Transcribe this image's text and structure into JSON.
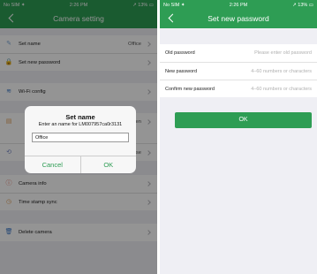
{
  "left": {
    "status": {
      "carrier": "No SIM ✦",
      "time": "2:26 PM",
      "battery": "↗ 13% ▭"
    },
    "title": "Camera setting",
    "items": [
      {
        "icon": "✎",
        "label": "Set name",
        "value": "Office",
        "icon_color": "#7da8d8"
      },
      {
        "icon": "🔒",
        "label": "Set new password",
        "value": "",
        "icon_color": "#e0a15a"
      },
      {
        "icon": "≋",
        "label": "Wi-Fi config",
        "value": "",
        "icon_color": "#3a78c8"
      },
      {
        "icon": "▤",
        "label": "",
        "value": "en",
        "icon_color": "#e0a15a"
      },
      {
        "icon": "⟲",
        "label": "",
        "value": "se",
        "icon_color": "#7a8ac8"
      },
      {
        "icon": "ⓘ",
        "label": "Camera info",
        "value": "",
        "icon_color": "#e06a5a"
      },
      {
        "icon": "◷",
        "label": "Time stamp sync",
        "value": "",
        "icon_color": "#e0a15a"
      },
      {
        "icon": "🗑",
        "label": "Delete camera",
        "value": "",
        "icon_color": "#3a78c8"
      }
    ]
  },
  "dialog": {
    "title": "Set name",
    "message": "Enter an name for LM007957ca0r3131",
    "value": "Office",
    "cancel": "Cancel",
    "ok": "OK"
  },
  "right": {
    "status": {
      "carrier": "No SIM ✦",
      "time": "2:26 PM",
      "battery": "↗ 13% ▭"
    },
    "title": "Set new password",
    "fields": [
      {
        "label": "Old password",
        "placeholder": "Please enter old password"
      },
      {
        "label": "New password",
        "placeholder": "4–60 numbers or characters"
      },
      {
        "label": "Confirm new password",
        "placeholder": "4–60 numbers or characters"
      }
    ],
    "ok": "OK"
  },
  "colors": {
    "accent": "#2e9d54",
    "background": "#efeff4"
  }
}
